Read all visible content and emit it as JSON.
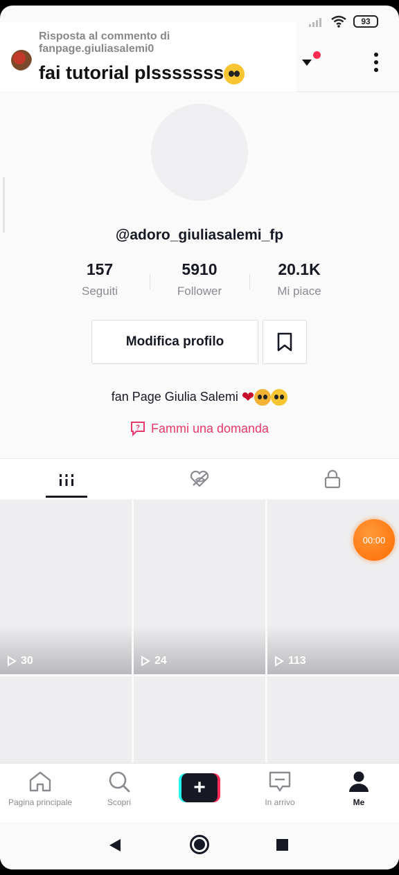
{
  "status_bar": {
    "battery": "93"
  },
  "comment": {
    "header_line1": "Risposta al commento di",
    "header_line2": "fanpage.giuliasalemi0",
    "text": "fai tutorial plsssssss"
  },
  "profile": {
    "username": "@adoro_giuliasalemi_fp",
    "stats": [
      {
        "value": "157",
        "label": "Seguiti"
      },
      {
        "value": "5910",
        "label": "Follower"
      },
      {
        "value": "20.1K",
        "label": "Mi piace"
      }
    ],
    "edit_label": "Modifica profilo",
    "bio": "fan Page Giulia Salemi",
    "qa_link": "Fammi una domanda"
  },
  "videos": [
    {
      "views": "30"
    },
    {
      "views": "24"
    },
    {
      "views": "113"
    }
  ],
  "timer": "00:00",
  "bottom_nav": {
    "home": "Pagina principale",
    "discover": "Scopri",
    "inbox": "In arrivo",
    "me": "Me"
  },
  "colors": {
    "accent": "#fe2c55",
    "link": "#e6386b",
    "timer": "#ff6a00"
  }
}
